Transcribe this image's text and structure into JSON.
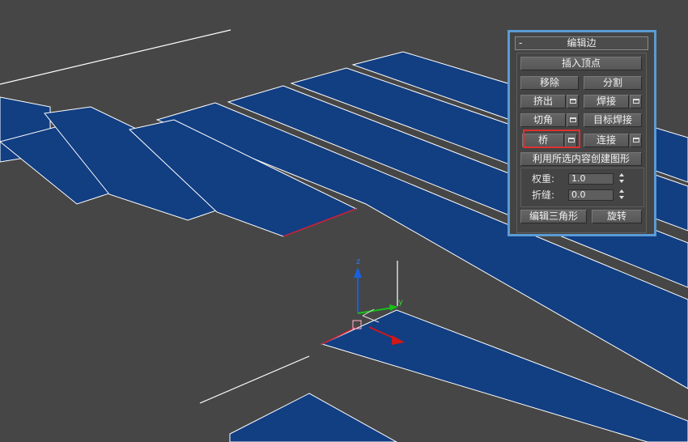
{
  "viewport": {
    "background_color": "#464646",
    "polygon_fill_color": "#123e82",
    "edge_color": "#ffffff",
    "selected_edge_color": "#c8203a",
    "gizmo": {
      "axis_z_label": "z",
      "axis_y_label": "y",
      "axis_x_color": "#d01818",
      "axis_y_color": "#18c018",
      "axis_z_color": "#1860e0"
    }
  },
  "panel": {
    "border_color": "#5b9bd5",
    "rollout_toggle": "-",
    "rollout_title": "编辑边",
    "buttons": {
      "insert_vertex": "插入顶点",
      "remove": "移除",
      "split": "分割",
      "extrude": "挤出",
      "weld": "焊接",
      "chamfer": "切角",
      "target_weld": "目标焊接",
      "bridge": "桥",
      "connect": "连接",
      "create_shape": "利用所选内容创建图形",
      "edit_triangulation": "编辑三角形",
      "turn": "旋转"
    },
    "weight_label": "权重:",
    "weight_value": "1.0",
    "crease_label": "折缝:",
    "crease_value": "0.0",
    "highlight_color": "#e03030"
  }
}
